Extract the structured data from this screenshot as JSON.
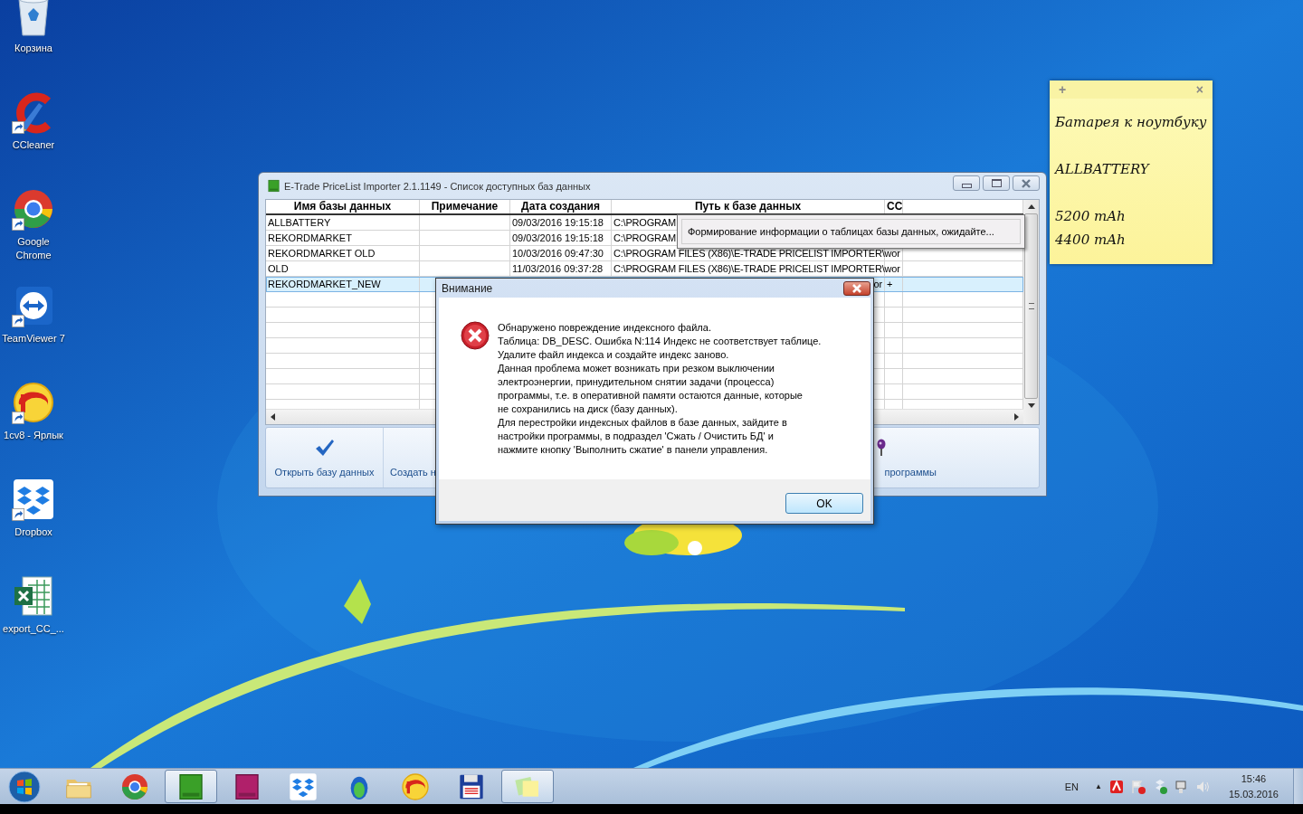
{
  "desktop_icons": [
    {
      "label": "Корзина",
      "kind": "recycle-bin",
      "shortcut": false
    },
    {
      "label": "CCleaner",
      "kind": "cleaner",
      "shortcut": true
    },
    {
      "label": "Google Chrome",
      "kind": "browser",
      "shortcut": true
    },
    {
      "label": "TeamViewer 7",
      "kind": "remote",
      "shortcut": true
    },
    {
      "label": "1cv8 - Ярлык",
      "kind": "accounting",
      "shortcut": true
    },
    {
      "label": "Dropbox",
      "kind": "cloud",
      "shortcut": true
    },
    {
      "label": "export_CC_...",
      "kind": "spreadsheet",
      "shortcut": false
    }
  ],
  "sticky_note": {
    "add": "+",
    "close": "×",
    "blocks": [
      [
        "Батарея к ноутбуку"
      ],
      [
        "ALLBATTERY"
      ],
      [
        "5200 mAh",
        "4400 mAh"
      ]
    ]
  },
  "main_window": {
    "title": "E-Trade PriceList Importer 2.1.1149 - Список доступных баз данных",
    "table": {
      "columns": [
        "Имя базы данных",
        "Примечание",
        "Дата создания",
        "Путь к базе данных",
        "CC"
      ],
      "rows": [
        {
          "name": "ALLBATTERY",
          "date": "09/03/2016 19:15:18",
          "path": "C:\\PROGRAM",
          "selected": false
        },
        {
          "name": "REKORDMARKET",
          "date": "09/03/2016 19:15:18",
          "path": "C:\\PROGRAM",
          "selected": false
        },
        {
          "name": "REKORDMARKET OLD",
          "date": "10/03/2016 09:47:30",
          "path": "C:\\PROGRAM FILES (X86)\\E-TRADE PRICELIST IMPORTER\\wor",
          "selected": false
        },
        {
          "name": "OLD",
          "date": "11/03/2016 09:37:28",
          "path": "C:\\PROGRAM FILES (X86)\\E-TRADE PRICELIST IMPORTER\\wor",
          "selected": false
        },
        {
          "name": "REKORDMARKET_NEW",
          "path_tail": "or",
          "cc": "+",
          "selected": true
        }
      ]
    },
    "toolbar": [
      {
        "label": "Открыть базу данных",
        "kind": "check"
      },
      {
        "label": "Создать н",
        "kind": "none"
      },
      {
        "label": "программы",
        "kind": "pin"
      }
    ]
  },
  "tooltip": {
    "text": "Формирование информации о таблицах базы данных, ожидайте..."
  },
  "dialog": {
    "title": "Внимание",
    "message": "Обнаружено повреждение индексного файла.\nТаблица: DB_DESC. Ошибка N:114 Индекс не соответствует таблице.\nУдалите файл индекса и создайте индекс заново.\nДанная проблема может возникать при резком выключении\nэлектроэнергии, принудительном снятии задачи (процесса)\nпрограммы, т.е. в оперативной памяти остаются данные, которые\nне сохранились на диск (базу данных).\nДля перестройки индексных файлов в базе данных, зайдите в\nнастройки программы, в подраздел 'Сжать / Очистить БД' и\nнажмите кнопку 'Выполнить сжатие' в панели управления.",
    "button": "OK"
  },
  "taskbar": {
    "apps": [
      {
        "kind": "folder",
        "active": false
      },
      {
        "kind": "browser",
        "active": false
      },
      {
        "kind": "green-app",
        "active": true
      },
      {
        "kind": "purple-app",
        "active": false
      },
      {
        "kind": "cloud",
        "active": false
      },
      {
        "kind": "egg",
        "active": false
      },
      {
        "kind": "accounting",
        "active": false
      },
      {
        "kind": "floppy",
        "active": false
      },
      {
        "kind": "notes",
        "active": true
      }
    ],
    "language": "EN",
    "tray_arrow": "▲",
    "time": "15:46",
    "date": "15.03.2016"
  }
}
